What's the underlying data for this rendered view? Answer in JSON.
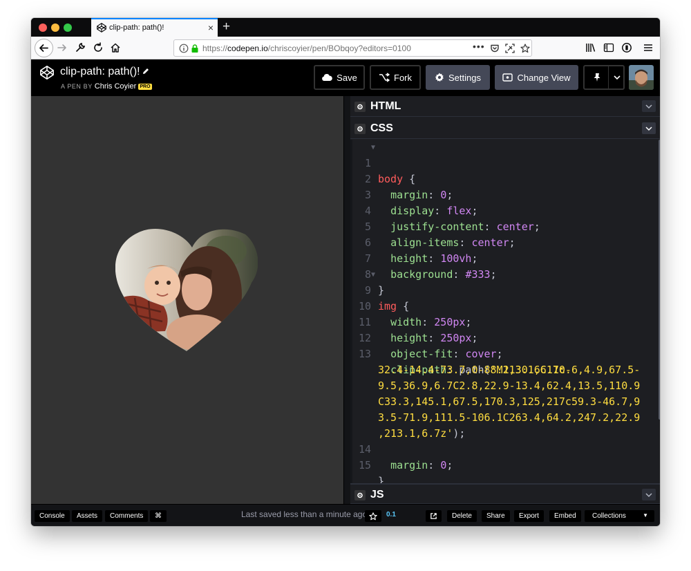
{
  "browser": {
    "tab_title": "clip-path: path()!",
    "url_prefix": "https://",
    "url_host": "codepen.io",
    "url_path": "/chriscoyier/pen/BObqoy?editors=0100",
    "icons": [
      "back-arrow-icon",
      "forward-arrow-icon",
      "wrench-icon",
      "reload-icon",
      "home-icon",
      "info-icon",
      "lock-icon",
      "more-icon",
      "pocket-icon",
      "screenshot-icon",
      "bookmark-star-icon",
      "library-icon",
      "reader-icon",
      "tracking-icon",
      "hamburger-menu-icon"
    ]
  },
  "header": {
    "title": "clip-path: path()!",
    "byline_prefix": "A PEN BY",
    "author": "Chris Coyier",
    "pro_badge": "PRO",
    "save_label": "Save",
    "fork_label": "Fork",
    "settings_label": "Settings",
    "change_view_label": "Change View"
  },
  "editors": {
    "html_label": "HTML",
    "css_label": "CSS",
    "js_label": "JS",
    "css_lines": [
      {
        "n": "1",
        "fold": true
      },
      {
        "n": "2"
      },
      {
        "n": "3"
      },
      {
        "n": "4"
      },
      {
        "n": "5"
      },
      {
        "n": "6"
      },
      {
        "n": "7"
      },
      {
        "n": "8"
      },
      {
        "n": "9",
        "fold": true
      },
      {
        "n": "10"
      },
      {
        "n": "11"
      },
      {
        "n": "12"
      },
      {
        "n": "13"
      },
      {
        "n": ""
      },
      {
        "n": ""
      },
      {
        "n": ""
      },
      {
        "n": ""
      },
      {
        "n": ""
      },
      {
        "n": "14"
      },
      {
        "n": "15"
      }
    ],
    "code": {
      "l1_sel": "body",
      "l1_brace": " {",
      "l2_prop": "margin",
      "l2_val": "0",
      "l3_prop": "display",
      "l3_val": "flex",
      "l4_prop": "justify-content",
      "l4_val": "center",
      "l5_prop": "align-items",
      "l5_val": "center",
      "l6_prop": "height",
      "l6_val": "100vh",
      "l7_prop": "background",
      "l7_val": "#333",
      "l8": "}",
      "l9_sel": "img",
      "l9_brace": " {",
      "l10_prop": "width",
      "l10_val": "250px",
      "l11_prop": "height",
      "l11_val": "250px",
      "l12_prop": "object-fit",
      "l12_val": "cover",
      "l13_prop": "clip-path",
      "l13_fn": "path(",
      "l13_s1": "'M213.1,6.7c-",
      "l13_s2": "32.4-14.4-73.7,0-88.1,30.6C110.6,4.9,67.5-",
      "l13_s3": "9.5,36.9,6.7C2.8,22.9-13.4,62.4,13.5,110.9",
      "l13_s4": "C33.3,145.1,67.5,170.3,125,217c59.3-46.7,9",
      "l13_s5": "3.5-71.9,111.5-106.1C263.4,64.2,247.2,22.9",
      "l13_s6": ",213.1,6.7z'",
      "l13_end": ");",
      "l14_prop": "margin",
      "l14_val": "0",
      "l15": "}"
    }
  },
  "footer": {
    "console": "Console",
    "assets": "Assets",
    "comments": "Comments",
    "shortcut": "⌘",
    "saved": "Last saved less than a minute ago",
    "version": "0.1",
    "delete": "Delete",
    "share": "Share",
    "export": "Export",
    "embed": "Embed",
    "collections": "Collections"
  },
  "colors": {
    "accent_tab": "#0a84ff",
    "pro_badge": "#ffdd40",
    "selector": "#ff5c5c",
    "property": "#9de091",
    "value": "#d187f3",
    "string": "#ffdd40"
  }
}
